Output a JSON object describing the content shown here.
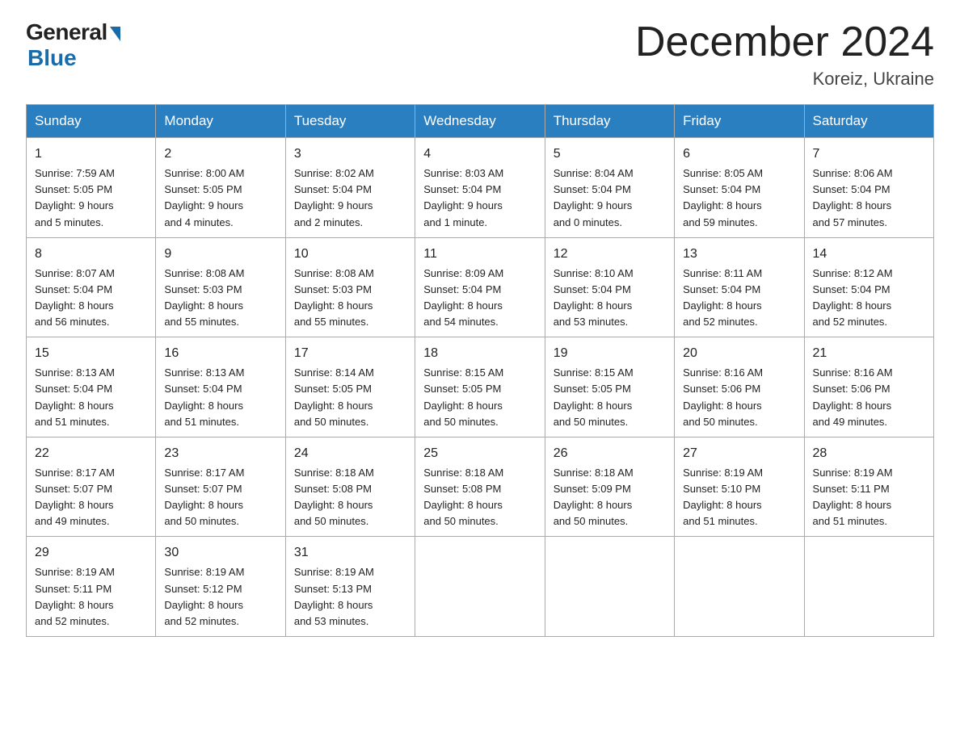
{
  "header": {
    "logo_general": "General",
    "logo_blue": "Blue",
    "month_title": "December 2024",
    "location": "Koreiz, Ukraine"
  },
  "weekdays": [
    "Sunday",
    "Monday",
    "Tuesday",
    "Wednesday",
    "Thursday",
    "Friday",
    "Saturday"
  ],
  "weeks": [
    [
      {
        "day": "1",
        "info": "Sunrise: 7:59 AM\nSunset: 5:05 PM\nDaylight: 9 hours\nand 5 minutes."
      },
      {
        "day": "2",
        "info": "Sunrise: 8:00 AM\nSunset: 5:05 PM\nDaylight: 9 hours\nand 4 minutes."
      },
      {
        "day": "3",
        "info": "Sunrise: 8:02 AM\nSunset: 5:04 PM\nDaylight: 9 hours\nand 2 minutes."
      },
      {
        "day": "4",
        "info": "Sunrise: 8:03 AM\nSunset: 5:04 PM\nDaylight: 9 hours\nand 1 minute."
      },
      {
        "day": "5",
        "info": "Sunrise: 8:04 AM\nSunset: 5:04 PM\nDaylight: 9 hours\nand 0 minutes."
      },
      {
        "day": "6",
        "info": "Sunrise: 8:05 AM\nSunset: 5:04 PM\nDaylight: 8 hours\nand 59 minutes."
      },
      {
        "day": "7",
        "info": "Sunrise: 8:06 AM\nSunset: 5:04 PM\nDaylight: 8 hours\nand 57 minutes."
      }
    ],
    [
      {
        "day": "8",
        "info": "Sunrise: 8:07 AM\nSunset: 5:04 PM\nDaylight: 8 hours\nand 56 minutes."
      },
      {
        "day": "9",
        "info": "Sunrise: 8:08 AM\nSunset: 5:03 PM\nDaylight: 8 hours\nand 55 minutes."
      },
      {
        "day": "10",
        "info": "Sunrise: 8:08 AM\nSunset: 5:03 PM\nDaylight: 8 hours\nand 55 minutes."
      },
      {
        "day": "11",
        "info": "Sunrise: 8:09 AM\nSunset: 5:04 PM\nDaylight: 8 hours\nand 54 minutes."
      },
      {
        "day": "12",
        "info": "Sunrise: 8:10 AM\nSunset: 5:04 PM\nDaylight: 8 hours\nand 53 minutes."
      },
      {
        "day": "13",
        "info": "Sunrise: 8:11 AM\nSunset: 5:04 PM\nDaylight: 8 hours\nand 52 minutes."
      },
      {
        "day": "14",
        "info": "Sunrise: 8:12 AM\nSunset: 5:04 PM\nDaylight: 8 hours\nand 52 minutes."
      }
    ],
    [
      {
        "day": "15",
        "info": "Sunrise: 8:13 AM\nSunset: 5:04 PM\nDaylight: 8 hours\nand 51 minutes."
      },
      {
        "day": "16",
        "info": "Sunrise: 8:13 AM\nSunset: 5:04 PM\nDaylight: 8 hours\nand 51 minutes."
      },
      {
        "day": "17",
        "info": "Sunrise: 8:14 AM\nSunset: 5:05 PM\nDaylight: 8 hours\nand 50 minutes."
      },
      {
        "day": "18",
        "info": "Sunrise: 8:15 AM\nSunset: 5:05 PM\nDaylight: 8 hours\nand 50 minutes."
      },
      {
        "day": "19",
        "info": "Sunrise: 8:15 AM\nSunset: 5:05 PM\nDaylight: 8 hours\nand 50 minutes."
      },
      {
        "day": "20",
        "info": "Sunrise: 8:16 AM\nSunset: 5:06 PM\nDaylight: 8 hours\nand 50 minutes."
      },
      {
        "day": "21",
        "info": "Sunrise: 8:16 AM\nSunset: 5:06 PM\nDaylight: 8 hours\nand 49 minutes."
      }
    ],
    [
      {
        "day": "22",
        "info": "Sunrise: 8:17 AM\nSunset: 5:07 PM\nDaylight: 8 hours\nand 49 minutes."
      },
      {
        "day": "23",
        "info": "Sunrise: 8:17 AM\nSunset: 5:07 PM\nDaylight: 8 hours\nand 50 minutes."
      },
      {
        "day": "24",
        "info": "Sunrise: 8:18 AM\nSunset: 5:08 PM\nDaylight: 8 hours\nand 50 minutes."
      },
      {
        "day": "25",
        "info": "Sunrise: 8:18 AM\nSunset: 5:08 PM\nDaylight: 8 hours\nand 50 minutes."
      },
      {
        "day": "26",
        "info": "Sunrise: 8:18 AM\nSunset: 5:09 PM\nDaylight: 8 hours\nand 50 minutes."
      },
      {
        "day": "27",
        "info": "Sunrise: 8:19 AM\nSunset: 5:10 PM\nDaylight: 8 hours\nand 51 minutes."
      },
      {
        "day": "28",
        "info": "Sunrise: 8:19 AM\nSunset: 5:11 PM\nDaylight: 8 hours\nand 51 minutes."
      }
    ],
    [
      {
        "day": "29",
        "info": "Sunrise: 8:19 AM\nSunset: 5:11 PM\nDaylight: 8 hours\nand 52 minutes."
      },
      {
        "day": "30",
        "info": "Sunrise: 8:19 AM\nSunset: 5:12 PM\nDaylight: 8 hours\nand 52 minutes."
      },
      {
        "day": "31",
        "info": "Sunrise: 8:19 AM\nSunset: 5:13 PM\nDaylight: 8 hours\nand 53 minutes."
      },
      {
        "day": "",
        "info": ""
      },
      {
        "day": "",
        "info": ""
      },
      {
        "day": "",
        "info": ""
      },
      {
        "day": "",
        "info": ""
      }
    ]
  ]
}
